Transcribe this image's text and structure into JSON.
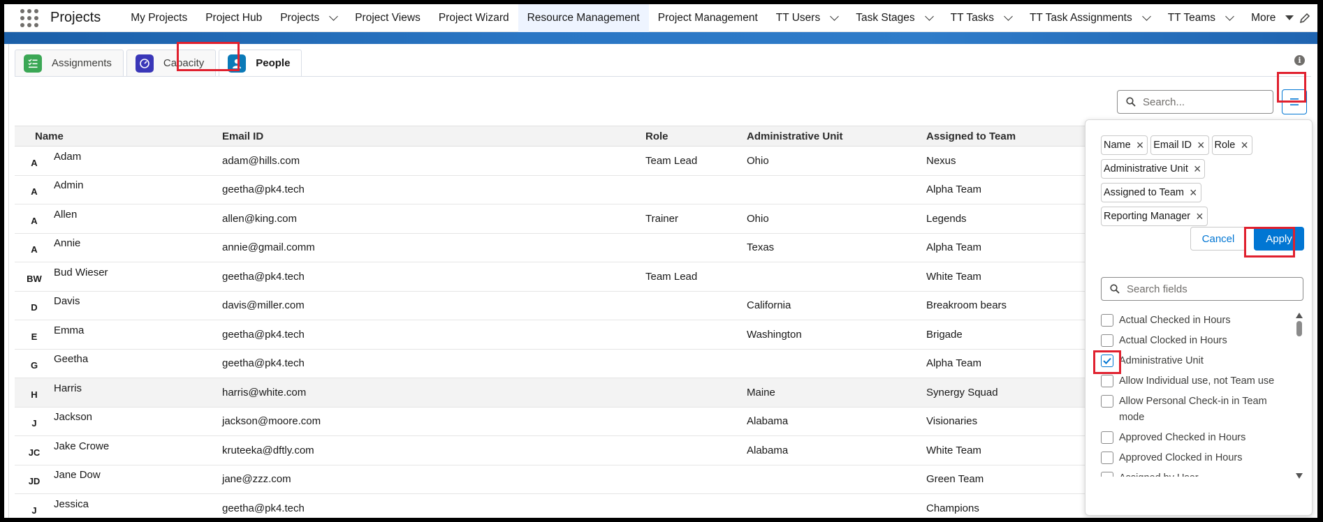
{
  "app": {
    "name": "Projects"
  },
  "nav": {
    "items": [
      {
        "label": "My Projects",
        "dropdown": false,
        "active": false
      },
      {
        "label": "Project Hub",
        "dropdown": false,
        "active": false
      },
      {
        "label": "Projects",
        "dropdown": true,
        "active": false
      },
      {
        "label": "Project Views",
        "dropdown": false,
        "active": false
      },
      {
        "label": "Project Wizard",
        "dropdown": false,
        "active": false
      },
      {
        "label": "Resource Management",
        "dropdown": false,
        "active": true
      },
      {
        "label": "Project Management",
        "dropdown": false,
        "active": false
      },
      {
        "label": "TT Users",
        "dropdown": true,
        "active": false
      },
      {
        "label": "Task Stages",
        "dropdown": true,
        "active": false
      },
      {
        "label": "TT Tasks",
        "dropdown": true,
        "active": false
      },
      {
        "label": "TT Task Assignments",
        "dropdown": true,
        "active": false
      },
      {
        "label": "TT Teams",
        "dropdown": true,
        "active": false
      }
    ],
    "more_label": "More"
  },
  "tabs": [
    {
      "label": "Assignments",
      "icon": "checklist-icon",
      "color": "#3ba755"
    },
    {
      "label": "Capacity",
      "icon": "gauge-icon",
      "color": "#3a37b8"
    },
    {
      "label": "People",
      "icon": "person-icon",
      "color": "#0b7ab8"
    }
  ],
  "search": {
    "placeholder": "Search..."
  },
  "table": {
    "columns": [
      "Name",
      "Email ID",
      "Role",
      "Administrative Unit",
      "Assigned to Team"
    ],
    "rows": [
      {
        "initials": "A",
        "name": "Adam",
        "email": "adam@hills.com",
        "role": "Team Lead",
        "unit": "Ohio",
        "team": "Nexus"
      },
      {
        "initials": "A",
        "name": "Admin",
        "email": "geetha@pk4.tech",
        "role": "",
        "unit": "",
        "team": "Alpha Team"
      },
      {
        "initials": "A",
        "name": "Allen",
        "email": "allen@king.com",
        "role": "Trainer",
        "unit": "Ohio",
        "team": "Legends"
      },
      {
        "initials": "A",
        "name": "Annie",
        "email": "annie@gmail.comm",
        "role": "",
        "unit": "Texas",
        "team": "Alpha Team"
      },
      {
        "initials": "BW",
        "name": "Bud Wieser",
        "email": "geetha@pk4.tech",
        "role": "Team Lead",
        "unit": "",
        "team": "White Team"
      },
      {
        "initials": "D",
        "name": "Davis",
        "email": "davis@miller.com",
        "role": "",
        "unit": "California",
        "team": "Breakroom bears"
      },
      {
        "initials": "E",
        "name": "Emma",
        "email": "geetha@pk4.tech",
        "role": "",
        "unit": "Washington",
        "team": "Brigade"
      },
      {
        "initials": "G",
        "name": "Geetha",
        "email": "geetha@pk4.tech",
        "role": "",
        "unit": "",
        "team": "Alpha Team"
      },
      {
        "initials": "H",
        "name": "Harris",
        "email": "harris@white.com",
        "role": "",
        "unit": "Maine",
        "team": "Synergy Squad"
      },
      {
        "initials": "J",
        "name": "Jackson",
        "email": "jackson@moore.com",
        "role": "",
        "unit": "Alabama",
        "team": "Visionaries"
      },
      {
        "initials": "JC",
        "name": "Jake Crowe",
        "email": "kruteeka@dftly.com",
        "role": "",
        "unit": "Alabama",
        "team": "White Team"
      },
      {
        "initials": "JD",
        "name": "Jane Dow",
        "email": "jane@zzz.com",
        "role": "",
        "unit": "",
        "team": "Green Team"
      },
      {
        "initials": "J",
        "name": "Jessica",
        "email": "geetha@pk4.tech",
        "role": "",
        "unit": "",
        "team": "Champions"
      }
    ]
  },
  "column_picker": {
    "selected_pills": [
      "Name",
      "Email ID",
      "Role",
      "Administrative Unit",
      "Assigned to Team",
      "Reporting Manager"
    ],
    "cancel_label": "Cancel",
    "apply_label": "Apply",
    "field_search_placeholder": "Search fields",
    "fields": [
      {
        "label": "Actual Checked in Hours",
        "checked": false
      },
      {
        "label": "Actual Clocked in Hours",
        "checked": false
      },
      {
        "label": "Administrative Unit",
        "checked": true
      },
      {
        "label": "Allow Individual use, not Team use",
        "checked": false
      },
      {
        "label": "Allow Personal Check-in in Team mode",
        "checked": false
      },
      {
        "label": "Approved Checked in Hours",
        "checked": false
      },
      {
        "label": "Approved Clocked in Hours",
        "checked": false
      },
      {
        "label": "Assigned by User",
        "checked": false
      }
    ]
  },
  "colors": {
    "accent": "#0176d3",
    "highlight": "#e0202e",
    "band": "#2a76c4"
  }
}
